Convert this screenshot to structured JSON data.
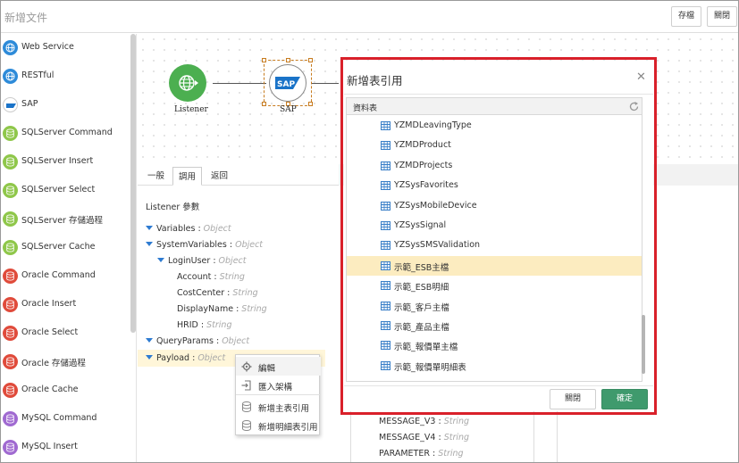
{
  "header": {
    "title": "新增文件",
    "save_label": "存檔",
    "close_label": "關閉"
  },
  "sidebar": {
    "items": [
      {
        "label": "Web Service",
        "icon": "globe-icon"
      },
      {
        "label": "RESTful",
        "icon": "globe-icon"
      },
      {
        "label": "SAP",
        "icon": "sap-icon"
      },
      {
        "label": "SQLServer Command",
        "icon": "database-icon"
      },
      {
        "label": "SQLServer Insert",
        "icon": "database-icon"
      },
      {
        "label": "SQLServer Select",
        "icon": "database-icon"
      },
      {
        "label": "SQLServer 存儲過程",
        "icon": "database-icon"
      },
      {
        "label": "SQLServer Cache",
        "icon": "database-icon"
      },
      {
        "label": "Oracle Command",
        "icon": "database-icon"
      },
      {
        "label": "Oracle Insert",
        "icon": "database-icon"
      },
      {
        "label": "Oracle Select",
        "icon": "database-icon"
      },
      {
        "label": "Oracle 存儲過程",
        "icon": "database-icon"
      },
      {
        "label": "Oracle Cache",
        "icon": "database-icon"
      },
      {
        "label": "MySQL Command",
        "icon": "database-icon"
      },
      {
        "label": "MySQL Insert",
        "icon": "database-icon"
      }
    ]
  },
  "canvas": {
    "nodes": [
      {
        "label": "Listener",
        "icon": "globe-arrow-icon"
      },
      {
        "label": "SAP",
        "logo": "SAP"
      }
    ]
  },
  "tabs": [
    {
      "label": "一般"
    },
    {
      "label": "調用"
    },
    {
      "label": "返回"
    }
  ],
  "tree": {
    "title": "Listener 參數",
    "nodes": [
      {
        "name": "Variables",
        "type": "Object"
      },
      {
        "name": "SystemVariables",
        "type": "Object"
      },
      {
        "name": "LoginUser",
        "type": "Object"
      },
      {
        "name": "Account",
        "type": "String"
      },
      {
        "name": "CostCenter",
        "type": "String"
      },
      {
        "name": "DisplayName",
        "type": "String"
      },
      {
        "name": "HRID",
        "type": "String"
      },
      {
        "name": "QueryParams",
        "type": "Object"
      },
      {
        "name": "Payload",
        "type": "Object"
      }
    ],
    "separator": " : "
  },
  "context_menu": {
    "items": [
      {
        "label": "編輯",
        "icon": "gear-icon"
      },
      {
        "label": "匯入架構",
        "icon": "import-icon"
      },
      {
        "label": "新增主表引用",
        "icon": "database-icon"
      },
      {
        "label": "新增明細表引用",
        "icon": "database-icon"
      }
    ]
  },
  "mid_panel": {
    "rows": [
      {
        "name": "MESSAGE_V3",
        "type": "String"
      },
      {
        "name": "MESSAGE_V4",
        "type": "String"
      },
      {
        "name": "PARAMETER",
        "type": "String"
      }
    ]
  },
  "modal": {
    "title": "新增表引用",
    "list_header": "資料表",
    "tables": [
      {
        "label": "YZMDLeavingType",
        "selected": false
      },
      {
        "label": "YZMDProduct",
        "selected": false
      },
      {
        "label": "YZMDProjects",
        "selected": false
      },
      {
        "label": "YZSysFavorites",
        "selected": false
      },
      {
        "label": "YZSysMobileDevice",
        "selected": false
      },
      {
        "label": "YZSysSignal",
        "selected": false
      },
      {
        "label": "YZSysSMSValidation",
        "selected": false
      },
      {
        "label": "示範_ESB主檔",
        "selected": true
      },
      {
        "label": "示範_ESB明細",
        "selected": false
      },
      {
        "label": "示範_客戶主檔",
        "selected": false
      },
      {
        "label": "示範_產品主檔",
        "selected": false
      },
      {
        "label": "示範_報價單主檔",
        "selected": false
      },
      {
        "label": "示範_報價單明細表",
        "selected": false
      }
    ],
    "close_label": "關閉",
    "ok_label": "確定"
  },
  "colors": {
    "accent_green": "#3f9a6d",
    "highlight_outline": "#d9202a",
    "selected_row": "#fcecc0"
  }
}
